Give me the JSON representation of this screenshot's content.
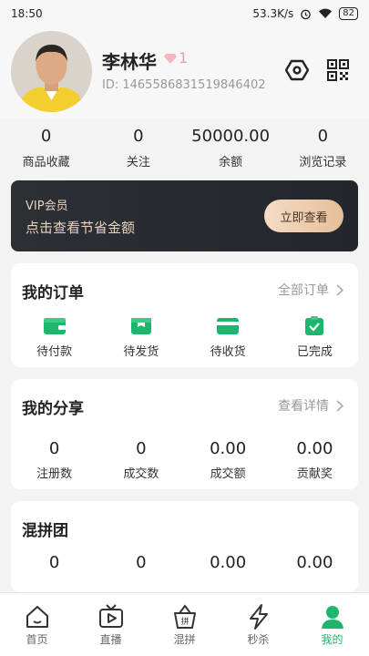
{
  "status": {
    "time": "18:50",
    "speed": "53.3K/s",
    "battery": "82"
  },
  "profile": {
    "name": "李林华",
    "level": "1",
    "id_label": "ID: 1465586831519846402"
  },
  "stats": [
    {
      "value": "0",
      "label": "商品收藏"
    },
    {
      "value": "0",
      "label": "关注"
    },
    {
      "value": "50000.00",
      "label": "余额"
    },
    {
      "value": "0",
      "label": "浏览记录"
    }
  ],
  "vip": {
    "title": "VIP会员",
    "subtitle": "点击查看节省金额",
    "button": "立即查看"
  },
  "orders": {
    "title": "我的订单",
    "link": "全部订单",
    "items": [
      {
        "label": "待付款",
        "icon": "wallet-icon"
      },
      {
        "label": "待发货",
        "icon": "box-icon"
      },
      {
        "label": "待收货",
        "icon": "card-icon"
      },
      {
        "label": "已完成",
        "icon": "check-clipboard-icon"
      }
    ]
  },
  "share": {
    "title": "我的分享",
    "link": "查看详情",
    "items": [
      {
        "value": "0",
        "label": "注册数"
      },
      {
        "value": "0",
        "label": "成交数"
      },
      {
        "value": "0.00",
        "label": "成交额"
      },
      {
        "value": "0.00",
        "label": "贡献奖"
      }
    ]
  },
  "group": {
    "title": "混拼团",
    "items": [
      {
        "value": "0"
      },
      {
        "value": "0"
      },
      {
        "value": "0.00"
      },
      {
        "value": "0.00"
      }
    ]
  },
  "nav": [
    {
      "label": "首页",
      "icon": "home-icon"
    },
    {
      "label": "直播",
      "icon": "tv-play-icon"
    },
    {
      "label": "混拼",
      "icon": "basket-icon"
    },
    {
      "label": "秒杀",
      "icon": "lightning-icon"
    },
    {
      "label": "我的",
      "icon": "person-icon"
    }
  ],
  "colors": {
    "accent": "#1eb66d",
    "vip_bg": "#2a2e33",
    "vip_text": "#e8d3bd",
    "vip_button": "#ecc9a6"
  }
}
